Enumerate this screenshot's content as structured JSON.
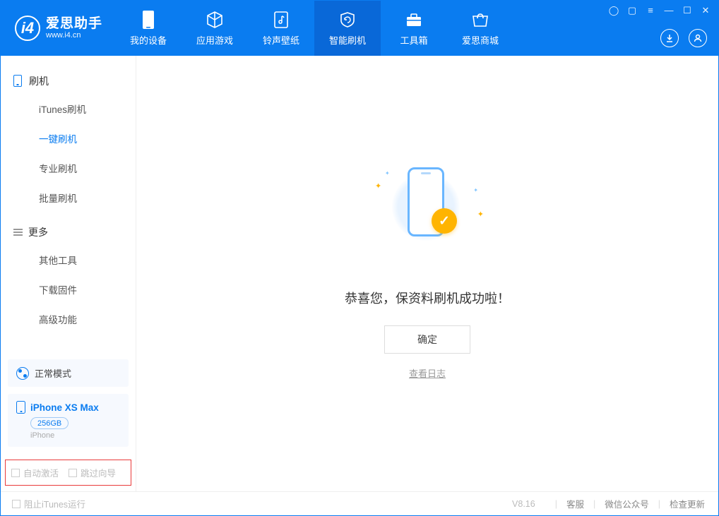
{
  "app": {
    "title": "爱思助手",
    "subtitle": "www.i4.cn"
  },
  "nav": {
    "items": [
      {
        "label": "我的设备"
      },
      {
        "label": "应用游戏"
      },
      {
        "label": "铃声壁纸"
      },
      {
        "label": "智能刷机"
      },
      {
        "label": "工具箱"
      },
      {
        "label": "爱思商城"
      }
    ]
  },
  "sidebar": {
    "group1_title": "刷机",
    "group1_items": [
      {
        "label": "iTunes刷机"
      },
      {
        "label": "一键刷机"
      },
      {
        "label": "专业刷机"
      },
      {
        "label": "批量刷机"
      }
    ],
    "group2_title": "更多",
    "group2_items": [
      {
        "label": "其他工具"
      },
      {
        "label": "下载固件"
      },
      {
        "label": "高级功能"
      }
    ],
    "mode_label": "正常模式",
    "device_name": "iPhone XS Max",
    "device_storage": "256GB",
    "device_type": "iPhone",
    "cb_auto_activate": "自动激活",
    "cb_skip_guide": "跳过向导"
  },
  "main": {
    "success_message": "恭喜您，保资料刷机成功啦！",
    "ok_button": "确定",
    "view_log": "查看日志"
  },
  "footer": {
    "block_itunes": "阻止iTunes运行",
    "version": "V8.16",
    "link_service": "客服",
    "link_wechat": "微信公众号",
    "link_update": "检查更新"
  }
}
